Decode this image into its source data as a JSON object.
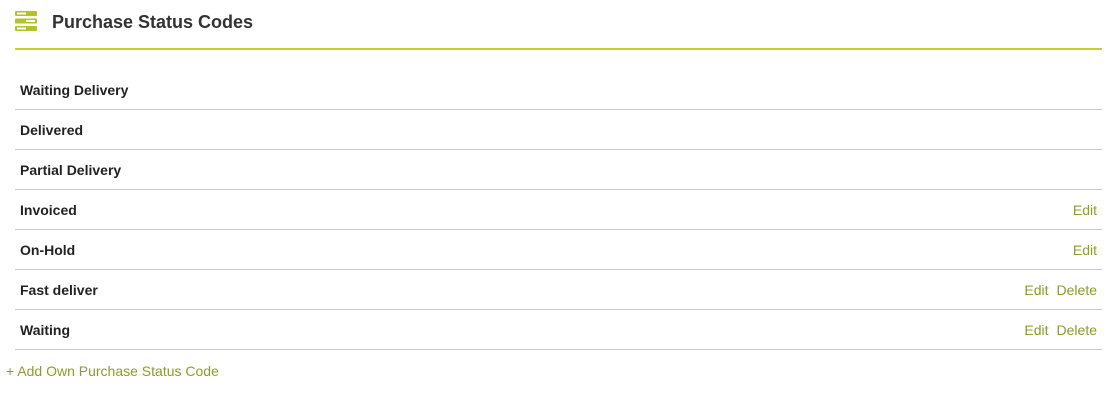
{
  "header": {
    "title": "Purchase Status Codes",
    "icon": "list-icon",
    "accent_color": "#c5d22e"
  },
  "statuses": [
    {
      "name": "Waiting Delivery",
      "actions": []
    },
    {
      "name": "Delivered",
      "actions": []
    },
    {
      "name": "Partial Delivery",
      "actions": []
    },
    {
      "name": "Invoiced",
      "actions": [
        "Edit"
      ]
    },
    {
      "name": "On-Hold",
      "actions": [
        "Edit"
      ]
    },
    {
      "name": "Fast deliver",
      "actions": [
        "Edit",
        "Delete"
      ]
    },
    {
      "name": "Waiting",
      "actions": [
        "Edit",
        "Delete"
      ]
    }
  ],
  "add_link": "+ Add Own Purchase Status Code",
  "link_color": "#8e9c28"
}
